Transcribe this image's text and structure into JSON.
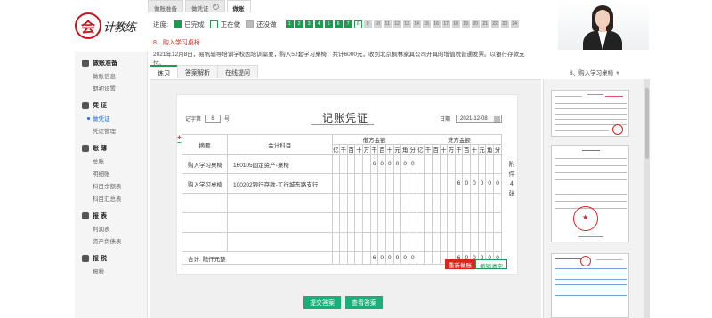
{
  "brand": {
    "mark": "会",
    "text": "计教练"
  },
  "top_tabs": [
    {
      "label": "做账准备",
      "closable": false,
      "active": false
    },
    {
      "label": "做凭证",
      "closable": true,
      "active": false
    },
    {
      "label": "做账",
      "closable": false,
      "active": true
    }
  ],
  "progress": {
    "label": "进度:",
    "legend": {
      "done": "已完成",
      "doing": "正在做",
      "none": "还没做"
    },
    "steps": [
      {
        "n": "1",
        "state": "done"
      },
      {
        "n": "2",
        "state": "done"
      },
      {
        "n": "3",
        "state": "done"
      },
      {
        "n": "4",
        "state": "done"
      },
      {
        "n": "5",
        "state": "done"
      },
      {
        "n": "6",
        "state": "done"
      },
      {
        "n": "7",
        "state": "done"
      },
      {
        "n": "8",
        "state": "cur"
      },
      {
        "n": "9",
        "state": "none"
      },
      {
        "n": "10",
        "state": "none"
      },
      {
        "n": "11",
        "state": "none"
      },
      {
        "n": "12",
        "state": "none"
      },
      {
        "n": "13",
        "state": "none"
      },
      {
        "n": "14",
        "state": "none"
      },
      {
        "n": "15",
        "state": "none"
      },
      {
        "n": "16",
        "state": "none"
      },
      {
        "n": "17",
        "state": "none"
      },
      {
        "n": "18",
        "state": "none"
      },
      {
        "n": "19",
        "state": "none"
      },
      {
        "n": "20",
        "state": "none"
      },
      {
        "n": "21",
        "state": "none"
      },
      {
        "n": "22",
        "state": "none"
      },
      {
        "n": "23",
        "state": "none"
      },
      {
        "n": "24",
        "state": "none"
      }
    ]
  },
  "question": {
    "title": "8、购入学习桌椅",
    "desc": "2021年12月8日，易帆辅导培训学校因培训需要，购入50套学习桌椅，共计6000元，收到北京枫林家具公司开具的增值税普通发票。以银行存款支付。"
  },
  "sidebar": [
    {
      "head": "做账准备",
      "items": [
        {
          "label": "做账信息",
          "active": false
        },
        {
          "label": "期初设置",
          "active": false
        }
      ]
    },
    {
      "head": "凭 证",
      "items": [
        {
          "label": "做凭证",
          "active": true
        },
        {
          "label": "凭证管理",
          "active": false
        }
      ]
    },
    {
      "head": "账 薄",
      "items": [
        {
          "label": "总账",
          "active": false
        },
        {
          "label": "明细账",
          "active": false
        },
        {
          "label": "科目余额表",
          "active": false
        },
        {
          "label": "科目汇总表",
          "active": false
        }
      ]
    },
    {
      "head": "报 表",
      "items": [
        {
          "label": "利润表",
          "active": false
        },
        {
          "label": "资产负债表",
          "active": false
        }
      ]
    },
    {
      "head": "报 税",
      "items": [
        {
          "label": "报税",
          "active": false
        }
      ]
    }
  ],
  "sub_tabs": [
    {
      "label": "练习",
      "active": true
    },
    {
      "label": "答案解析",
      "active": false
    },
    {
      "label": "在线提问",
      "active": false
    }
  ],
  "right_select": "8、购入学习桌椅",
  "voucher": {
    "title": "记账凭证",
    "no_label_prefix": "记字第",
    "no_value": "8",
    "no_label_suffix": "号",
    "date_label": "日期",
    "date_value": "2021-12-08",
    "col_summary": "摘要",
    "col_account": "会计科目",
    "col_debit": "借方金额",
    "col_credit": "贷方金额",
    "digit_units": [
      "亿",
      "千",
      "百",
      "十",
      "万",
      "千",
      "百",
      "十",
      "元",
      "角",
      "分"
    ],
    "rows": [
      {
        "summary": "购入学习桌椅",
        "account": "160105固定资产-桌椅",
        "debit": [
          "",
          "",
          "",
          "",
          "",
          "6",
          "0",
          "0",
          "0",
          "0",
          "0"
        ],
        "credit": [
          "",
          "",
          "",
          "",
          "",
          "",
          "",
          "",
          "",
          "",
          ""
        ]
      },
      {
        "summary": "购入学习桌椅",
        "account": "100202银行存款-工行城东路支行",
        "debit": [
          "",
          "",
          "",
          "",
          "",
          "",
          "",
          "",
          "",
          "",
          ""
        ],
        "credit": [
          "",
          "",
          "",
          "",
          "",
          "6",
          "0",
          "0",
          "0",
          "0",
          "0"
        ]
      },
      {
        "summary": "",
        "account": "",
        "debit": [
          "",
          "",
          "",
          "",
          "",
          "",
          "",
          "",
          "",
          "",
          ""
        ],
        "credit": [
          "",
          "",
          "",
          "",
          "",
          "",
          "",
          "",
          "",
          "",
          ""
        ]
      },
      {
        "summary": "",
        "account": "",
        "debit": [
          "",
          "",
          "",
          "",
          "",
          "",
          "",
          "",
          "",
          "",
          ""
        ],
        "credit": [
          "",
          "",
          "",
          "",
          "",
          "",
          "",
          "",
          "",
          "",
          ""
        ]
      },
      {
        "summary": "",
        "account": "",
        "debit": [
          "",
          "",
          "",
          "",
          "",
          "",
          "",
          "",
          "",
          "",
          ""
        ],
        "credit": [
          "",
          "",
          "",
          "",
          "",
          "",
          "",
          "",
          "",
          "",
          ""
        ]
      }
    ],
    "total_label": "合计: 陆仟元整",
    "total_debit": [
      "",
      "",
      "",
      "",
      "",
      "6",
      "0",
      "0",
      "0",
      "0",
      "0"
    ],
    "total_credit": [
      "",
      "",
      "",
      "",
      "",
      "6",
      "0",
      "0",
      "0",
      "0",
      "0"
    ],
    "attach_label": "附件",
    "attach_count": "4",
    "attach_unit": "张",
    "reset_button": "重新做账",
    "clear_button": "撤销清空"
  },
  "buttons": {
    "submit": "提交答案",
    "answer": "查看答案"
  }
}
